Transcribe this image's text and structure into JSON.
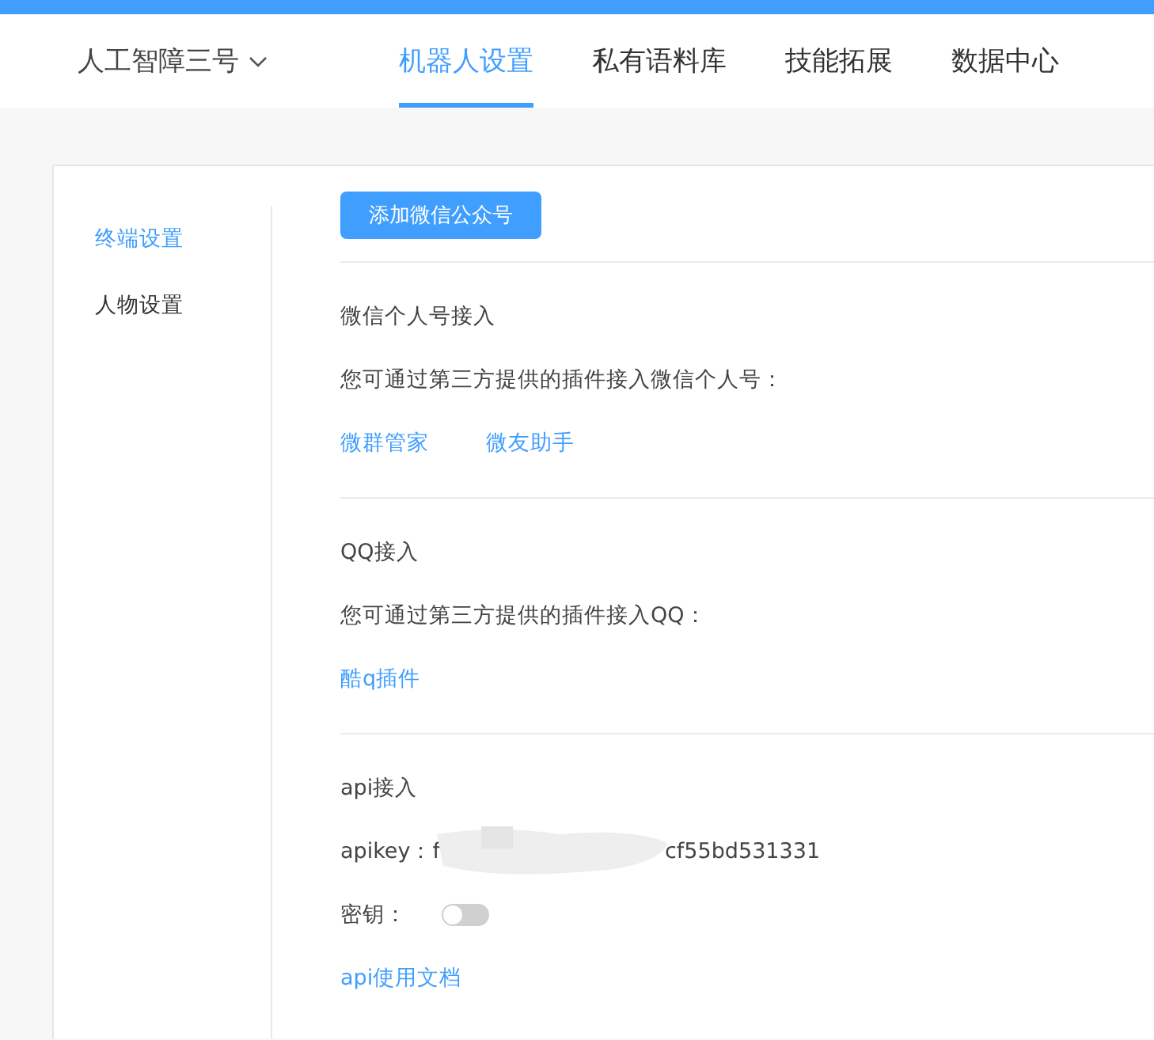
{
  "header": {
    "bot_name": "人工智障三号",
    "tabs": [
      {
        "label": "机器人设置",
        "selected": true
      },
      {
        "label": "私有语料库",
        "selected": false
      },
      {
        "label": "技能拓展",
        "selected": false
      },
      {
        "label": "数据中心",
        "selected": false
      }
    ]
  },
  "sidebar": {
    "items": [
      {
        "label": "终端设置",
        "selected": true
      },
      {
        "label": "人物设置",
        "selected": false
      }
    ]
  },
  "top_button": {
    "label": "添加微信公众号"
  },
  "sections": [
    {
      "kind": "links",
      "title": "微信个人号接入",
      "description": "您可通过第三方提供的插件接入微信个人号：",
      "links": [
        "微群管家",
        "微友助手"
      ]
    },
    {
      "kind": "links",
      "title": "QQ接入",
      "description": "您可通过第三方提供的插件接入QQ：",
      "links": [
        "酷q插件"
      ]
    },
    {
      "kind": "api",
      "title": "api接入",
      "apikey_label": "apikey：",
      "apikey_start": "f",
      "apikey_end": "cf55bd531331",
      "secret_label": "密钥：",
      "secret_on": false,
      "doc_link": "api使用文档"
    }
  ]
}
